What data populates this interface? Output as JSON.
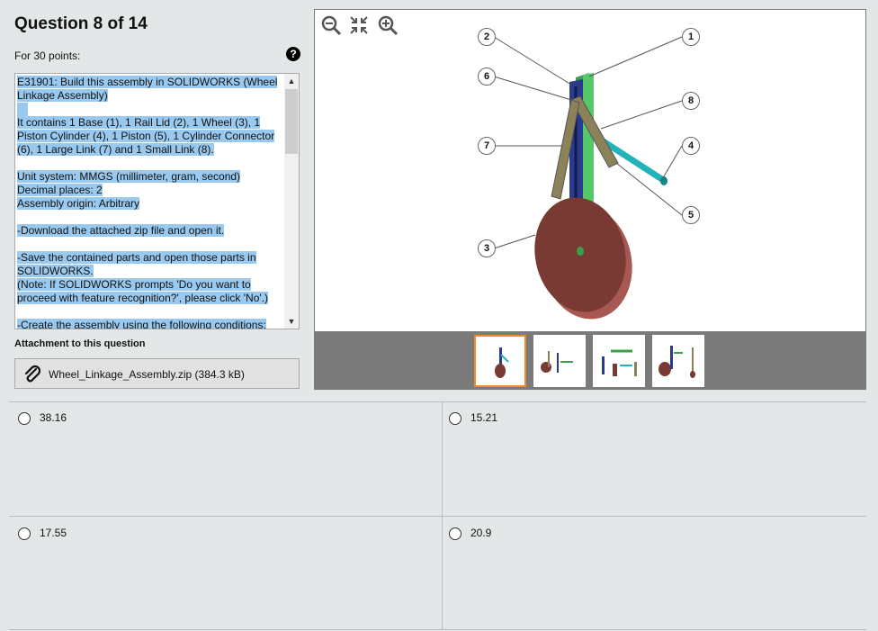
{
  "question": {
    "title": "Question 8 of 14",
    "points": "For 30 points:"
  },
  "description": {
    "paragraphs": [
      "E31901:  Build this assembly in SOLIDWORKS (Wheel Linkage Assembly)",
      "It contains 1 Base (1), 1 Rail Lid (2), 1 Wheel (3), 1 Piston Cylinder (4), 1 Piston (5), 1 Cylinder Connector (6), 1 Large Link (7) and 1 Small Link (8).",
      "Unit system: MMGS (millimeter, gram, second)",
      "Decimal places: 2",
      "Assembly origin: Arbitrary",
      "-Download the attached zip file and open it.",
      "-Save the contained parts and open those parts in SOLIDWORKS.",
      "(Note: If SOLIDWORKS prompts 'Do you want to proceed with feature recognition?', please click 'No'.)",
      "-Create the assembly using the following conditions:"
    ]
  },
  "attachment": {
    "label": "Attachment to this question",
    "filename": "Wheel_Linkage_Assembly.zip (384.3 kB)"
  },
  "viewer": {
    "callouts": [
      "1",
      "2",
      "3",
      "4",
      "5",
      "6",
      "7",
      "8"
    ],
    "tools": [
      "zoom-out-icon",
      "fit-icon",
      "zoom-in-icon"
    ],
    "thumbnail_count": 4,
    "active_thumbnail": 1
  },
  "answers": [
    {
      "value": "38.16"
    },
    {
      "value": "15.21"
    },
    {
      "value": "17.55"
    },
    {
      "value": "20.9"
    }
  ],
  "colors": {
    "selection": "#99c9ef",
    "thumb_active": "#f08a24",
    "wheel": "#7a3a34",
    "rail": "#2a3a8c",
    "base": "#4caf50",
    "piston": "#21b3b8"
  }
}
